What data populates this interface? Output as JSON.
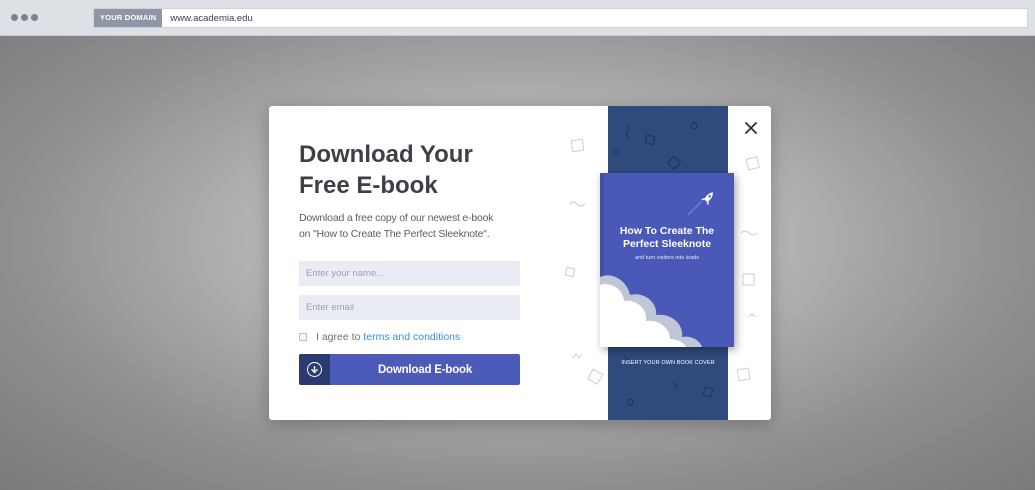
{
  "browser": {
    "domain_tag": "YOUR DOMAIN",
    "url": "www.academia.edu"
  },
  "popup": {
    "headline": "Download Your\nFree E-book",
    "description": "Download a free copy of our newest e-book\non \"How to Create The Perfect Sleeknote\".",
    "name_placeholder": "Enter your name...",
    "email_placeholder": "Enter email",
    "agree_text": "I agree to",
    "terms_link": "terms and conditions",
    "button_label": "Download E-book",
    "book": {
      "title": "How To Create The\nPerfect Sleeknote",
      "subtitle": "and turn visitors into leads",
      "caption": "INSERT YOUR OWN BOOK COVER"
    }
  },
  "icons": {
    "close": "close-icon",
    "download": "download-arrow-icon",
    "rocket": "rocket-icon",
    "browser_dots": "window-controls-icon"
  },
  "colors": {
    "accent": "#4b5bb7",
    "accent_dark": "#2b3a6f",
    "book_column": "#2f4a7c",
    "link": "#3d8bd6",
    "headline": "#3e3f47"
  }
}
